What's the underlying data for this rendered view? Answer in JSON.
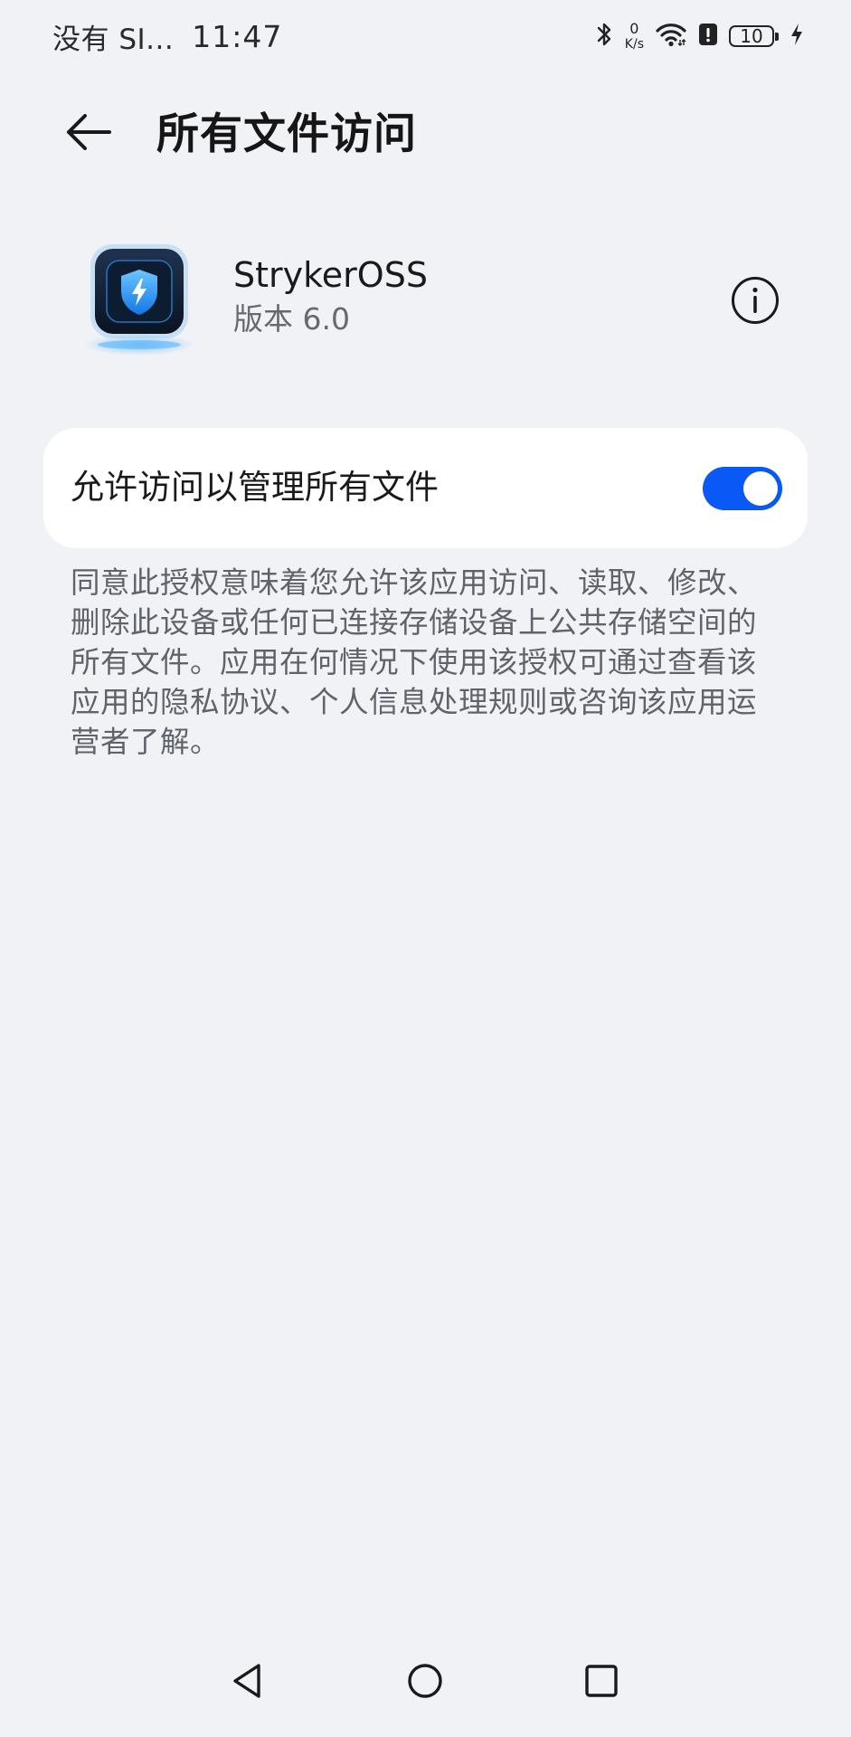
{
  "status_bar": {
    "carrier": "没有 SI...",
    "time": "11:47",
    "net_speed_value": "0",
    "net_speed_unit": "K/s",
    "battery_level": "10",
    "icons": [
      "bluetooth-icon",
      "wifi-icon",
      "alert-icon",
      "battery-icon",
      "charging-icon"
    ]
  },
  "header": {
    "title": "所有文件访问",
    "back_icon": "arrow-left-icon"
  },
  "app": {
    "name": "StrykerOSS",
    "version": "版本 6.0",
    "info_icon": "info-icon"
  },
  "permission": {
    "label": "允许访问以管理所有文件",
    "enabled": true,
    "toggle_color": "#0a59f7"
  },
  "description": "同意此授权意味着您允许该应用访问、读取、修改、删除此设备或任何已连接存储设备上公共存储空间的所有文件。应用在何情况下使用该授权可通过查看该应用的隐私协议、个人信息处理规则或咨询该应用运营者了解。",
  "nav_bar": {
    "icons": [
      "nav-back-icon",
      "nav-home-icon",
      "nav-recent-icon"
    ]
  }
}
